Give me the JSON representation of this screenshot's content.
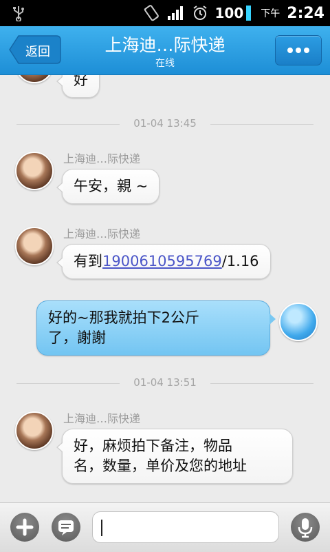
{
  "status_bar": {
    "battery": "100",
    "ampm": "下午",
    "time": "2:24"
  },
  "header": {
    "back_label": "返回",
    "title": "上海迪…际快递",
    "status": "在线"
  },
  "messages": [
    {
      "text": "好"
    },
    {
      "timestamp": "01-04 13:45"
    },
    {
      "sender": "上海迪…际快递",
      "text": "午安，親 ~"
    },
    {
      "sender": "上海迪…际快递",
      "text_before": "有到",
      "link": "1900610595769",
      "text_after": "/1.16"
    },
    {
      "mine": true,
      "line1": "好的~那我就拍下2公斤",
      "line2": "了，謝謝"
    },
    {
      "timestamp": "01-04 13:51"
    },
    {
      "sender": "上海迪…际快递",
      "line1": "好，麻烦拍下备注，物品",
      "line2": "名，数量，单价及您的地址"
    }
  ],
  "input": {
    "value": "",
    "placeholder": ""
  },
  "icons": {
    "add": "plus-icon",
    "emoji": "chat-bubble-icon",
    "voice": "microphone-icon",
    "more": "more-dots-icon"
  },
  "colors": {
    "title_bar": "#2a9fe3",
    "my_bubble": "#8fd2f6",
    "link": "#4a55c8"
  }
}
